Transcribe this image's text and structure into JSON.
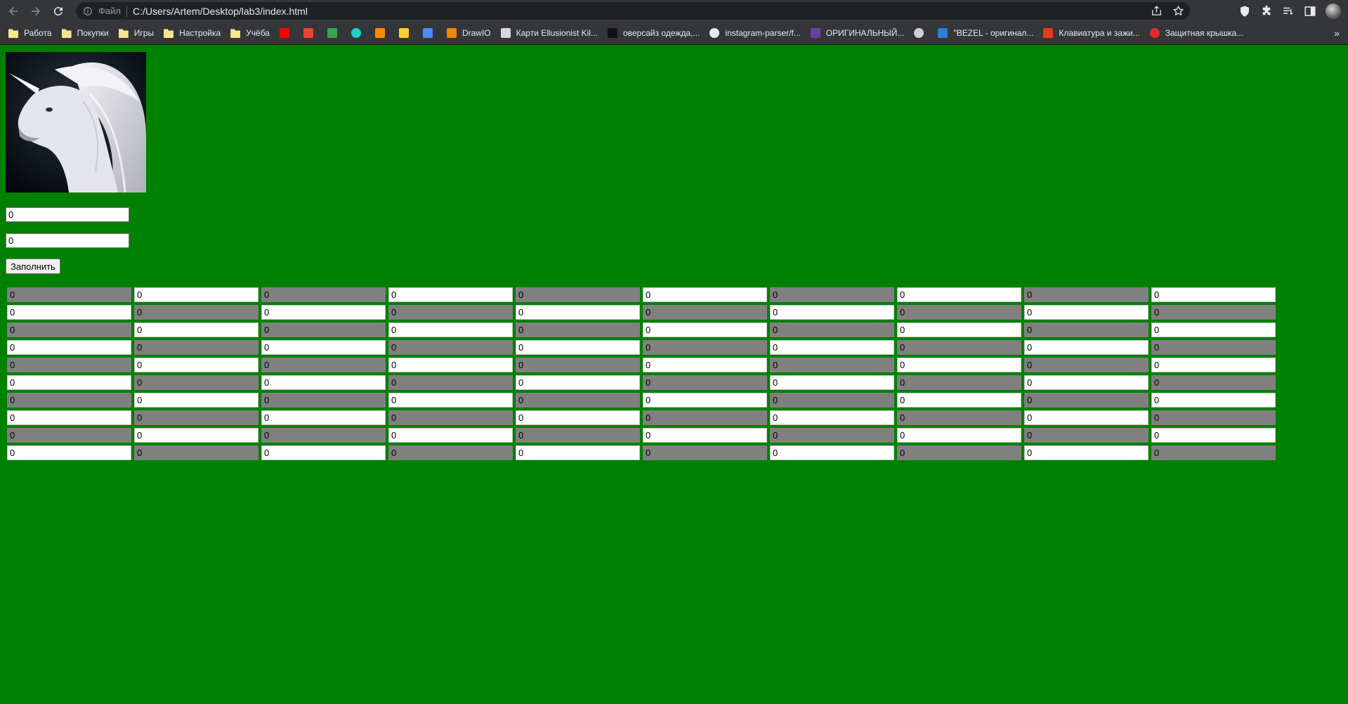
{
  "browser": {
    "scheme_label": "Файл",
    "url": "C:/Users/Artem/Desktop/lab3/index.html",
    "bookmarks": [
      {
        "label": "Работа",
        "icon": "folder-icon"
      },
      {
        "label": "Покупки",
        "icon": "folder-icon"
      },
      {
        "label": "Игры",
        "icon": "folder-icon"
      },
      {
        "label": "Настройка",
        "icon": "folder-icon"
      },
      {
        "label": "Учёба",
        "icon": "folder-icon"
      },
      {
        "label": "",
        "icon": "youtube-icon"
      },
      {
        "label": "",
        "icon": "gmail-icon"
      },
      {
        "label": "",
        "icon": "pinwheel-icon"
      },
      {
        "label": "",
        "icon": "ok-icon"
      },
      {
        "label": "",
        "icon": "diamond-icon"
      },
      {
        "label": "",
        "icon": "miro-icon"
      },
      {
        "label": "",
        "icon": "shield-icon"
      },
      {
        "label": "DrawIO",
        "icon": "drawio-icon"
      },
      {
        "label": "Карти Ellusionist Kil...",
        "icon": "flower-icon"
      },
      {
        "label": "оверсайз одежда,...",
        "icon": "bird-icon"
      },
      {
        "label": "instagram-parser/f...",
        "icon": "github-icon"
      },
      {
        "label": "ОРИГИНАЛЬНЫЙ...",
        "icon": "purple-square-icon"
      },
      {
        "label": "",
        "icon": "globe-icon"
      },
      {
        "label": "\"BEZEL - оригинал...",
        "icon": "b-icon"
      },
      {
        "label": "Клавиатура и зажи...",
        "icon": "red-square-icon"
      },
      {
        "label": "Защитная крышка...",
        "icon": "red-star-icon"
      }
    ],
    "overflow_label": "»"
  },
  "page": {
    "rows_input_value": "0",
    "cols_input_value": "0",
    "fill_button_label": "Заполнить",
    "grid": [
      [
        "0",
        "0",
        "0",
        "0",
        "0",
        "0",
        "0",
        "0",
        "0",
        "0"
      ],
      [
        "0",
        "0",
        "0",
        "0",
        "0",
        "0",
        "0",
        "0",
        "0",
        "0"
      ],
      [
        "0",
        "0",
        "0",
        "0",
        "0",
        "0",
        "0",
        "0",
        "0",
        "0"
      ],
      [
        "0",
        "0",
        "0",
        "0",
        "0",
        "0",
        "0",
        "0",
        "0",
        "0"
      ],
      [
        "0",
        "0",
        "0",
        "0",
        "0",
        "0",
        "0",
        "0",
        "0",
        "0"
      ],
      [
        "0",
        "0",
        "0",
        "0",
        "0",
        "0",
        "0",
        "0",
        "0",
        "0"
      ],
      [
        "0",
        "0",
        "0",
        "0",
        "0",
        "0",
        "0",
        "0",
        "0",
        "0"
      ],
      [
        "0",
        "0",
        "0",
        "0",
        "0",
        "0",
        "0",
        "0",
        "0",
        "0"
      ],
      [
        "0",
        "0",
        "0",
        "0",
        "0",
        "0",
        "0",
        "0",
        "0",
        "0"
      ],
      [
        "0",
        "0",
        "0",
        "0",
        "0",
        "0",
        "0",
        "0",
        "0",
        "0"
      ]
    ]
  },
  "colors": {
    "page_background": "#008000",
    "cell_light": "#ffffff",
    "cell_dark": "#808080"
  }
}
